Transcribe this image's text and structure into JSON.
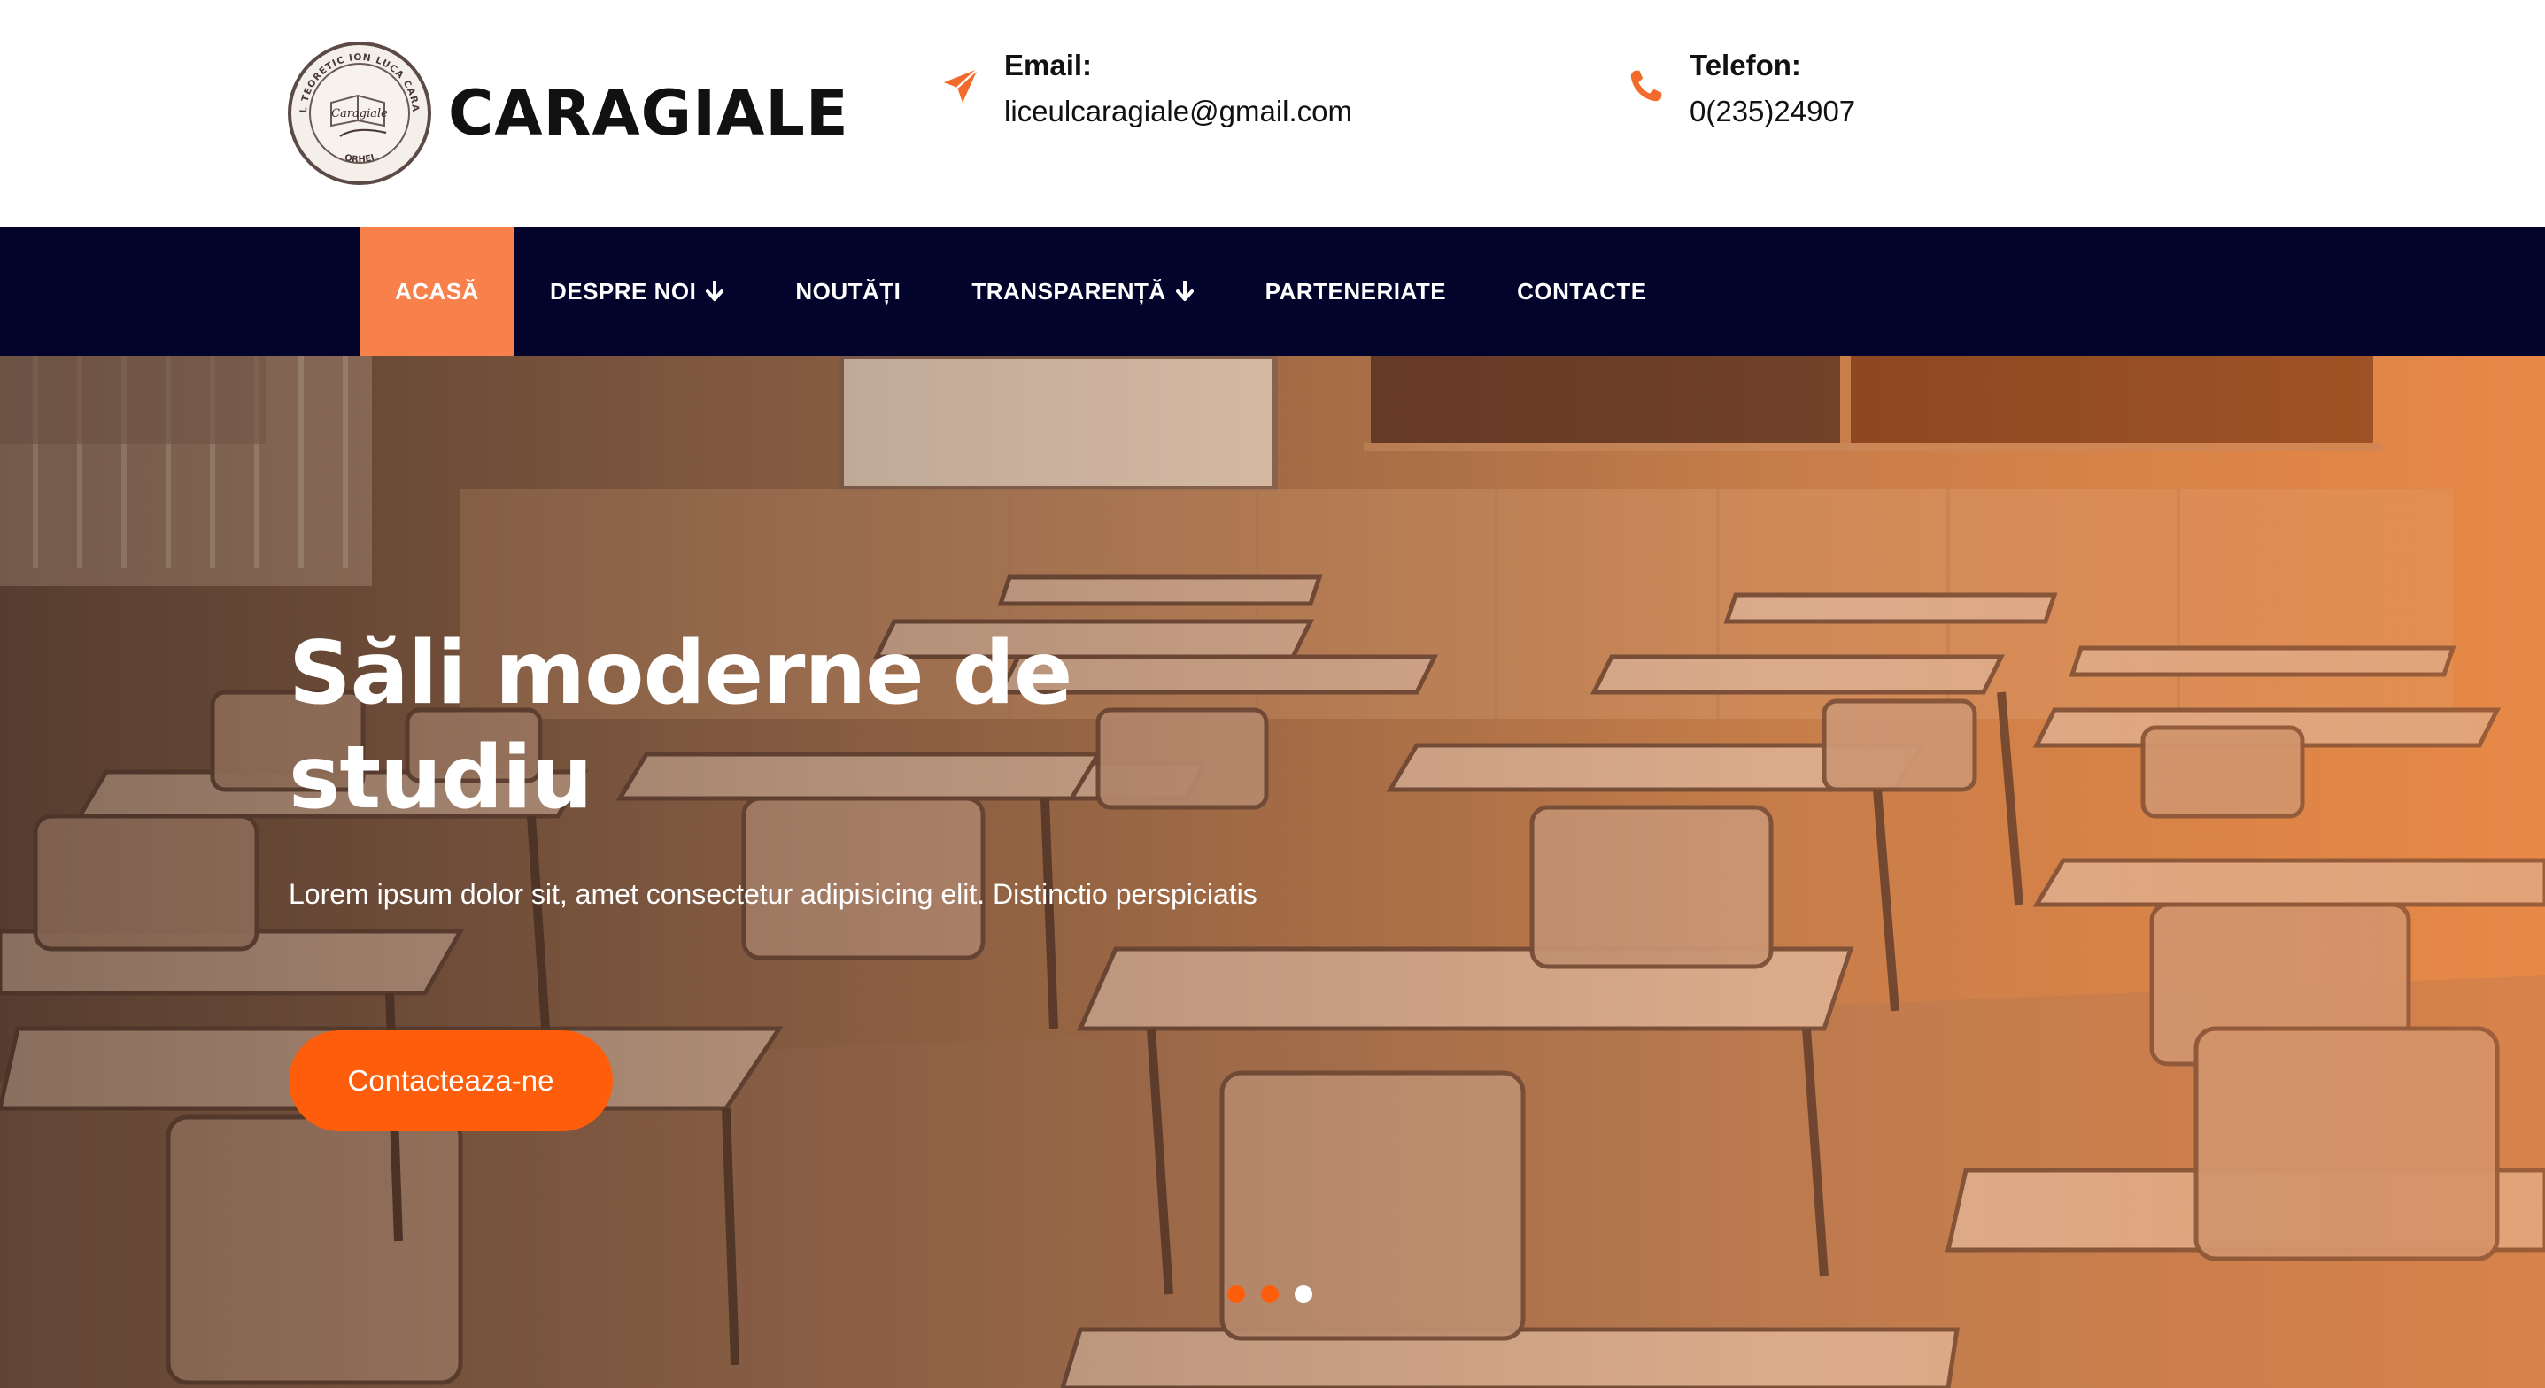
{
  "brand": {
    "name": "CARAGIALE",
    "seal_text_top": "LICEUL TEORETIC ION LUCA CARAGIALE",
    "seal_text_bottom": "ORHEI",
    "seal_signature": "Caragiale"
  },
  "contacts": {
    "email": {
      "label": "Email:",
      "value": "liceulcaragiale@gmail.com",
      "icon": "paper-plane-icon"
    },
    "phone": {
      "label": "Telefon:",
      "value": "0(235)24907",
      "icon": "phone-icon"
    }
  },
  "nav": {
    "items": [
      {
        "label": "ACASĂ",
        "active": true,
        "dropdown": false
      },
      {
        "label": "DESPRE NOI",
        "active": false,
        "dropdown": true
      },
      {
        "label": "NOUTĂȚI",
        "active": false,
        "dropdown": false
      },
      {
        "label": "TRANSPARENȚĂ",
        "active": false,
        "dropdown": true
      },
      {
        "label": "PARTENERIATE",
        "active": false,
        "dropdown": false
      },
      {
        "label": "CONTACTE",
        "active": false,
        "dropdown": false
      }
    ]
  },
  "hero": {
    "title": "Săli moderne de studiu",
    "text": "Lorem ipsum dolor sit, amet consectetur adipisicing elit. Distinctio perspiciatis",
    "button_label": "Contacteaza-ne",
    "slides": {
      "count": 3,
      "active_index": 2
    }
  },
  "colors": {
    "accent": "#fe5d0b",
    "nav_active": "#f7804b",
    "nav_background": "#03042c",
    "icon_orange": "#f26b2a"
  }
}
